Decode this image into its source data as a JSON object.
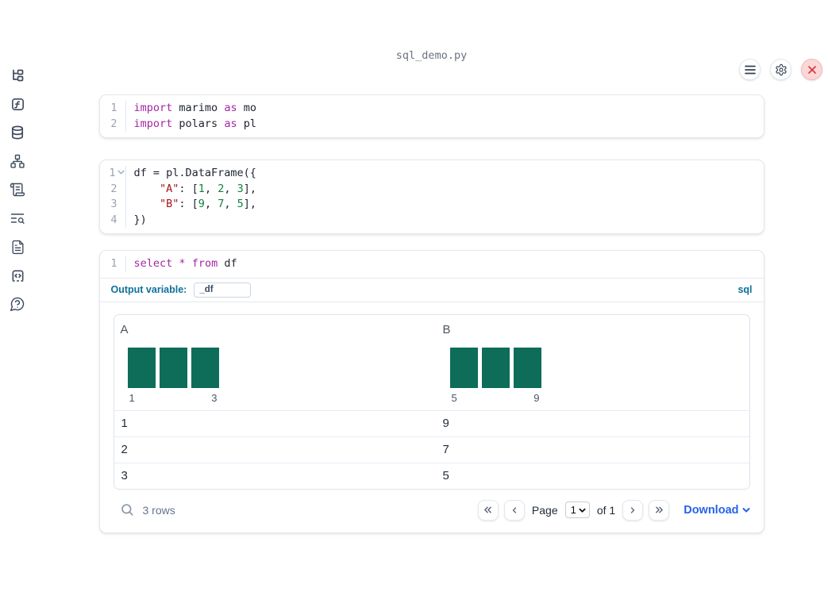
{
  "app": {
    "filename": "sql_demo.py"
  },
  "sidebar": {
    "items": [
      {
        "icon": "file-explorer-tree-icon"
      },
      {
        "icon": "variables-function-icon"
      },
      {
        "icon": "datasources-database-icon"
      },
      {
        "icon": "dependency-graph-icon"
      },
      {
        "icon": "scratchpad-scroll-icon"
      },
      {
        "icon": "logs-search-icon"
      },
      {
        "icon": "documentation-file-icon"
      },
      {
        "icon": "snippets-code-icon"
      },
      {
        "icon": "help-question-bubble-icon"
      }
    ]
  },
  "topbar": {
    "buttons": [
      {
        "icon": "menu-icon"
      },
      {
        "icon": "settings-gear-icon"
      },
      {
        "icon": "shutdown-close-icon"
      }
    ]
  },
  "cells": [
    {
      "name": "imports",
      "lines": [
        {
          "n": "1",
          "tokens": [
            [
              "kw",
              "import"
            ],
            [
              "pl",
              " marimo "
            ],
            [
              "kw",
              "as"
            ],
            [
              "pl",
              " mo"
            ]
          ]
        },
        {
          "n": "2",
          "tokens": [
            [
              "kw",
              "import"
            ],
            [
              "pl",
              " polars "
            ],
            [
              "kw",
              "as"
            ],
            [
              "pl",
              " pl"
            ]
          ]
        }
      ]
    },
    {
      "name": "dataframe",
      "lines": [
        {
          "n": "1",
          "fold": true,
          "tokens": [
            [
              "pl",
              "df = pl.DataFrame({"
            ]
          ]
        },
        {
          "n": "2",
          "tokens": [
            [
              "pl",
              "    "
            ],
            [
              "str",
              "\"A\""
            ],
            [
              "pl",
              ": ["
            ],
            [
              "num",
              "1"
            ],
            [
              "pl",
              ", "
            ],
            [
              "num",
              "2"
            ],
            [
              "pl",
              ", "
            ],
            [
              "num",
              "3"
            ],
            [
              "pl",
              "],"
            ]
          ]
        },
        {
          "n": "3",
          "tokens": [
            [
              "pl",
              "    "
            ],
            [
              "str",
              "\"B\""
            ],
            [
              "pl",
              ": ["
            ],
            [
              "num",
              "9"
            ],
            [
              "pl",
              ", "
            ],
            [
              "num",
              "7"
            ],
            [
              "pl",
              ", "
            ],
            [
              "num",
              "5"
            ],
            [
              "pl",
              "],"
            ]
          ]
        },
        {
          "n": "4",
          "tokens": [
            [
              "pl",
              "})"
            ]
          ]
        }
      ]
    },
    {
      "name": "sql",
      "lines": [
        {
          "n": "1",
          "tokens": [
            [
              "kw",
              "select"
            ],
            [
              "pl",
              " "
            ],
            [
              "kw",
              "*"
            ],
            [
              "pl",
              " "
            ],
            [
              "kw",
              "from"
            ],
            [
              "pl",
              " df"
            ]
          ]
        }
      ]
    }
  ],
  "sql_cell": {
    "output_variable_label": "Output variable:",
    "output_variable_value": "_df",
    "dialect": "sql"
  },
  "table": {
    "columns": [
      {
        "name": "A",
        "histogram": {
          "bar_count": 3,
          "min_label": "1",
          "max_label": "3"
        }
      },
      {
        "name": "B",
        "histogram": {
          "bar_count": 3,
          "min_label": "5",
          "max_label": "9"
        }
      }
    ],
    "rows": [
      [
        "1",
        "9"
      ],
      [
        "2",
        "7"
      ],
      [
        "3",
        "5"
      ]
    ],
    "footer": {
      "row_count": "3 rows",
      "page_label": "Page",
      "page_value": "1",
      "page_total_label": "of 1",
      "download_label": "Download"
    }
  },
  "colors": {
    "accent_blue": "#2563eb",
    "meta_blue": "#0e7199",
    "histogram_teal": "#0d6d59",
    "keyword_purple": "#a626a4",
    "string_red": "#a31515",
    "number_green": "#15803d",
    "close_red": "#d63a3a"
  }
}
